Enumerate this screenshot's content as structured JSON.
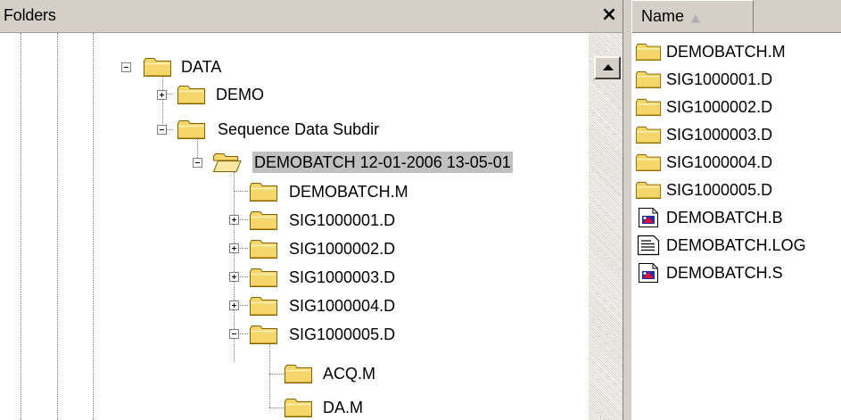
{
  "folders_pane": {
    "title": "Folders",
    "close_glyph": "×"
  },
  "tree": {
    "items": [
      {
        "label": "DATA",
        "expander": "minus",
        "icon": "folder-icon"
      },
      {
        "label": "DEMO",
        "expander": "plus",
        "icon": "folder-icon"
      },
      {
        "label": "Sequence Data Subdir",
        "expander": "minus",
        "icon": "folder-icon"
      },
      {
        "label": "DEMOBATCH 12-01-2006 13-05-01",
        "expander": "minus",
        "icon": "folder-open-icon",
        "selected": true
      },
      {
        "label": "DEMOBATCH.M",
        "expander": "none",
        "icon": "folder-icon"
      },
      {
        "label": "SIG1000001.D",
        "expander": "plus",
        "icon": "folder-icon"
      },
      {
        "label": "SIG1000002.D",
        "expander": "plus",
        "icon": "folder-icon"
      },
      {
        "label": "SIG1000003.D",
        "expander": "plus",
        "icon": "folder-icon"
      },
      {
        "label": "SIG1000004.D",
        "expander": "plus",
        "icon": "folder-icon"
      },
      {
        "label": "SIG1000005.D",
        "expander": "minus",
        "icon": "folder-icon"
      },
      {
        "label": "ACQ.M",
        "expander": "none",
        "icon": "folder-icon"
      },
      {
        "label": "DA.M",
        "expander": "none",
        "icon": "folder-icon"
      }
    ]
  },
  "file_list": {
    "column_name": "Name",
    "sort_glyph": "▲",
    "items": [
      {
        "label": "DEMOBATCH.M",
        "icon": "folder-icon"
      },
      {
        "label": "SIG1000001.D",
        "icon": "folder-icon"
      },
      {
        "label": "SIG1000002.D",
        "icon": "folder-icon"
      },
      {
        "label": "SIG1000003.D",
        "icon": "folder-icon"
      },
      {
        "label": "SIG1000004.D",
        "icon": "folder-icon"
      },
      {
        "label": "SIG1000005.D",
        "icon": "folder-icon"
      },
      {
        "label": "DEMOBATCH.B",
        "icon": "batch-file-icon"
      },
      {
        "label": "DEMOBATCH.LOG",
        "icon": "text-file-icon"
      },
      {
        "label": "DEMOBATCH.S",
        "icon": "batch-file-icon"
      }
    ]
  },
  "colors": {
    "folder_fill": "#f5d66a",
    "folder_outline": "#806000",
    "selection": "#c0c0c0",
    "chrome": "#d4d0c8"
  }
}
